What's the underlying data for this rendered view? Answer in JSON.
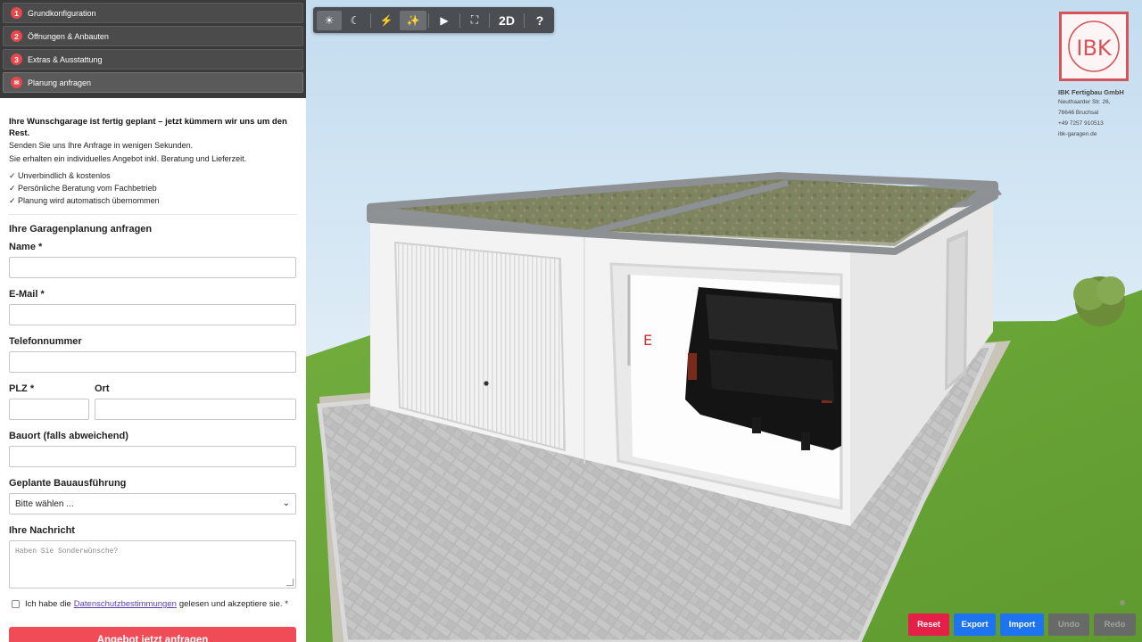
{
  "steps": [
    {
      "num": "1",
      "label": "Grundkonfiguration"
    },
    {
      "num": "2",
      "label": "Öffnungen & Anbauten"
    },
    {
      "num": "3",
      "label": "Extras & Ausstattung"
    },
    {
      "num": "✉",
      "label": "Planung anfragen"
    }
  ],
  "intro": {
    "title": "Ihre Wunschgarage ist fertig geplant – jetzt kümmern wir uns um den Rest.",
    "p1": "Senden Sie uns Ihre Anfrage in wenigen Sekunden.",
    "p2": "Sie erhalten ein individuelles Angebot inkl. Beratung und Lieferzeit.",
    "benefits": [
      "Unverbindlich & kostenlos",
      "Persönliche Beratung vom Fachbetrieb",
      "Planung wird automatisch übernommen"
    ]
  },
  "form": {
    "title": "Ihre Garagenplanung anfragen",
    "name_label": "Name *",
    "email_label": "E-Mail *",
    "phone_label": "Telefonnummer",
    "plz_label": "PLZ *",
    "ort_label": "Ort",
    "bauort_label": "Bauort (falls abweichend)",
    "ausfuehrung_label": "Geplante Bauausführung",
    "ausfuehrung_value": "Bitte wählen ...",
    "message_label": "Ihre Nachricht",
    "message_placeholder": "Haben Sie Sonderwünsche?",
    "consent_pre": "Ich habe die",
    "consent_link": "Datenschutzbestimmungen",
    "consent_post": "gelesen und akzeptiere sie. *",
    "submit": "Angebot jetzt anfragen"
  },
  "toolbar": {
    "sun": "☀",
    "moon": "☾",
    "flash": "⚡",
    "sparkle": "✨",
    "play": "▶",
    "fullscreen": "⛶",
    "twod": "2D",
    "help": "?"
  },
  "company": {
    "logo_text": "IBK",
    "name": "IBK Fertigbau GmbH",
    "street": "Neuthaarder Str. 26,",
    "city": "76646 Bruchsal",
    "phone": "+49 7257 910513",
    "web": "ibk-garagen.de"
  },
  "scene_label": "E",
  "bottombar": {
    "reset": "Reset",
    "export": "Export",
    "import": "Import",
    "undo": "Undo",
    "redo": "Redo"
  },
  "colors": {
    "accent": "#f04c58",
    "blue": "#1e74f0",
    "reset": "#e42048",
    "panel_dark": "#3a3a3a"
  }
}
